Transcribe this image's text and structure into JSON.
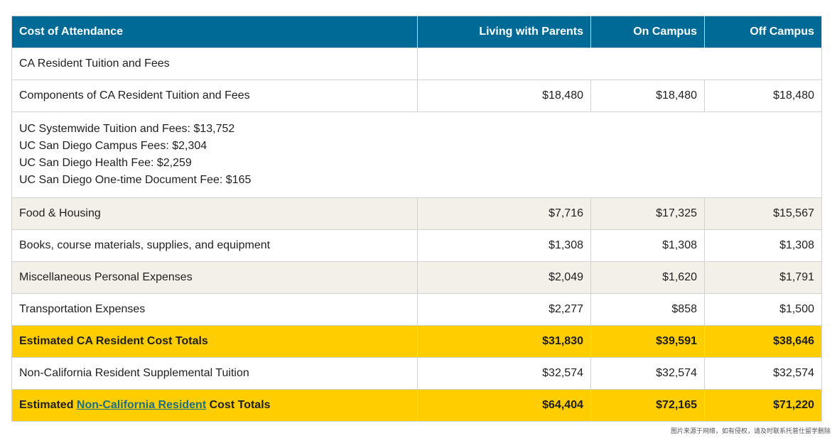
{
  "table": {
    "headers": [
      "Cost of Attendance",
      "Living with Parents",
      "On Campus",
      "Off Campus"
    ],
    "rows": {
      "ca_tuition": {
        "label": "CA Resident Tuition and Fees"
      },
      "components": {
        "label": "Components of CA Resident Tuition and Fees",
        "values": [
          "$18,480",
          "$18,480",
          "$18,480"
        ]
      },
      "breakdown": {
        "lines": [
          "UC Systemwide Tuition and Fees: $13,752",
          "UC San Diego Campus Fees: $2,304",
          "UC San Diego Health Fee: $2,259",
          "UC San Diego One-time Document Fee: $165"
        ]
      },
      "food": {
        "label": "Food & Housing",
        "values": [
          "$7,716",
          "$17,325",
          "$15,567"
        ]
      },
      "books": {
        "label": "Books, course materials, supplies, and equipment",
        "values": [
          "$1,308",
          "$1,308",
          "$1,308"
        ]
      },
      "misc": {
        "label": "Miscellaneous Personal Expenses",
        "values": [
          "$2,049",
          "$1,620",
          "$1,791"
        ]
      },
      "transport": {
        "label": "Transportation Expenses",
        "values": [
          "$2,277",
          "$858",
          "$1,500"
        ]
      },
      "ca_total": {
        "label": "Estimated CA Resident Cost Totals",
        "values": [
          "$31,830",
          "$39,591",
          "$38,646"
        ]
      },
      "nonres_supp": {
        "label": "Non-California Resident Supplemental Tuition",
        "values": [
          "$32,574",
          "$32,574",
          "$32,574"
        ]
      },
      "nonres_total": {
        "label_prefix": "Estimated ",
        "label_link": "Non-California Resident",
        "label_suffix": " Cost Totals",
        "values": [
          "$64,404",
          "$72,165",
          "$71,220"
        ]
      }
    }
  },
  "watermark": "图片来源于网络，如有侵权，请及时联系托普仕留学删除"
}
